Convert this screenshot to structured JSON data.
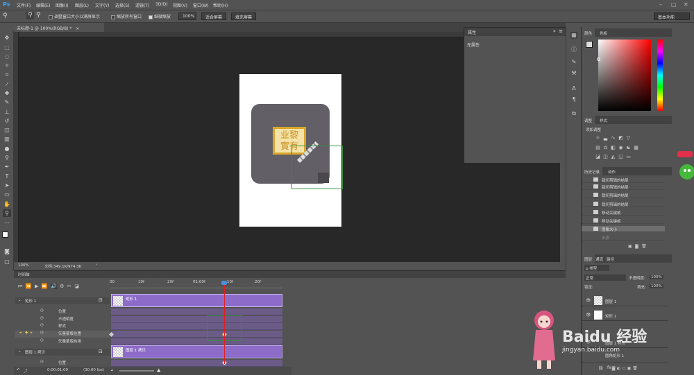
{
  "menubar": {
    "logo": "Ps",
    "items": [
      "文件(F)",
      "编辑(E)",
      "图像(I)",
      "图层(L)",
      "文字(Y)",
      "选择(S)",
      "滤镜(T)",
      "3D(D)",
      "视图(V)",
      "窗口(W)",
      "帮助(H)"
    ],
    "win_min": "–",
    "win_max": "□",
    "win_close": "✕"
  },
  "optionsbar": {
    "resize_windows": "调整窗口大小以满屏显示",
    "zoom_all": "缩放所有窗口",
    "scrubby_zoom": "细微缩放",
    "zoom_value": "100%",
    "fit_screen": "适合屏幕",
    "fill_screen": "填充屏幕",
    "workspace": "基本功能"
  },
  "document": {
    "tab_title": "未标题-1 @ 100%(RGB/8) *",
    "close": "×",
    "seal_text": "业黎\n實有"
  },
  "status": {
    "zoom": "100%",
    "doc_info": "文档:349.1K/974.3K",
    "arrow": "›"
  },
  "properties": {
    "tab": "属性",
    "empty": "无属性"
  },
  "color_panel": {
    "tabs": [
      "颜色",
      "色板"
    ]
  },
  "adjust_panel": {
    "tabs": [
      "调整",
      "样式"
    ],
    "title": "添加调整"
  },
  "history_panel": {
    "tabs": [
      "历史记录",
      "动作"
    ],
    "items": [
      "栽切剪辑的结尾",
      "栽切剪辑的结尾",
      "栽切剪辑的结尾",
      "栽切剪辑的结尾",
      "移动关键帧",
      "移动关键帧",
      "图像大小",
      "步骤"
    ],
    "selected_index": 6
  },
  "layers_panel": {
    "tabs": [
      "图层",
      "通道",
      "路径"
    ],
    "kind": "ρ 类型",
    "blend": "正常",
    "opacity_label": "不透明度:",
    "opacity": "100%",
    "lock_label": "锁定:",
    "fill_label": "填充:",
    "fill": "100%",
    "layers": [
      "图层 1",
      "矩形 1",
      "图层 1 拷贝",
      "圆角矩形 1"
    ],
    "fx": "fx"
  },
  "timeline": {
    "tab": "时间轴",
    "ruler": [
      "00",
      "10f",
      "20f",
      "01:00f",
      "10f",
      "20f"
    ],
    "layers": [
      {
        "name": "矩形 1",
        "props": [
          "位置",
          "不透明度",
          "样式",
          "矢量蒙版位置",
          "矢量蒙版启用"
        ]
      },
      {
        "name": "图层 1 拷贝",
        "props": [
          "位置"
        ]
      }
    ],
    "clip1": "矩形 1",
    "clip2": "图层 1 拷贝",
    "timecode": "0:00:01:09",
    "fps": "(30.00 fps)"
  },
  "watermark": {
    "brand": "Baidu 经验",
    "url": "jingyan.baidu.com"
  },
  "colors": {
    "accent": "#31a8ff",
    "clip": "#8d6cc9",
    "playhead": "#e02020",
    "selection": "#3a8c3a",
    "seal": "#d9a72c"
  }
}
